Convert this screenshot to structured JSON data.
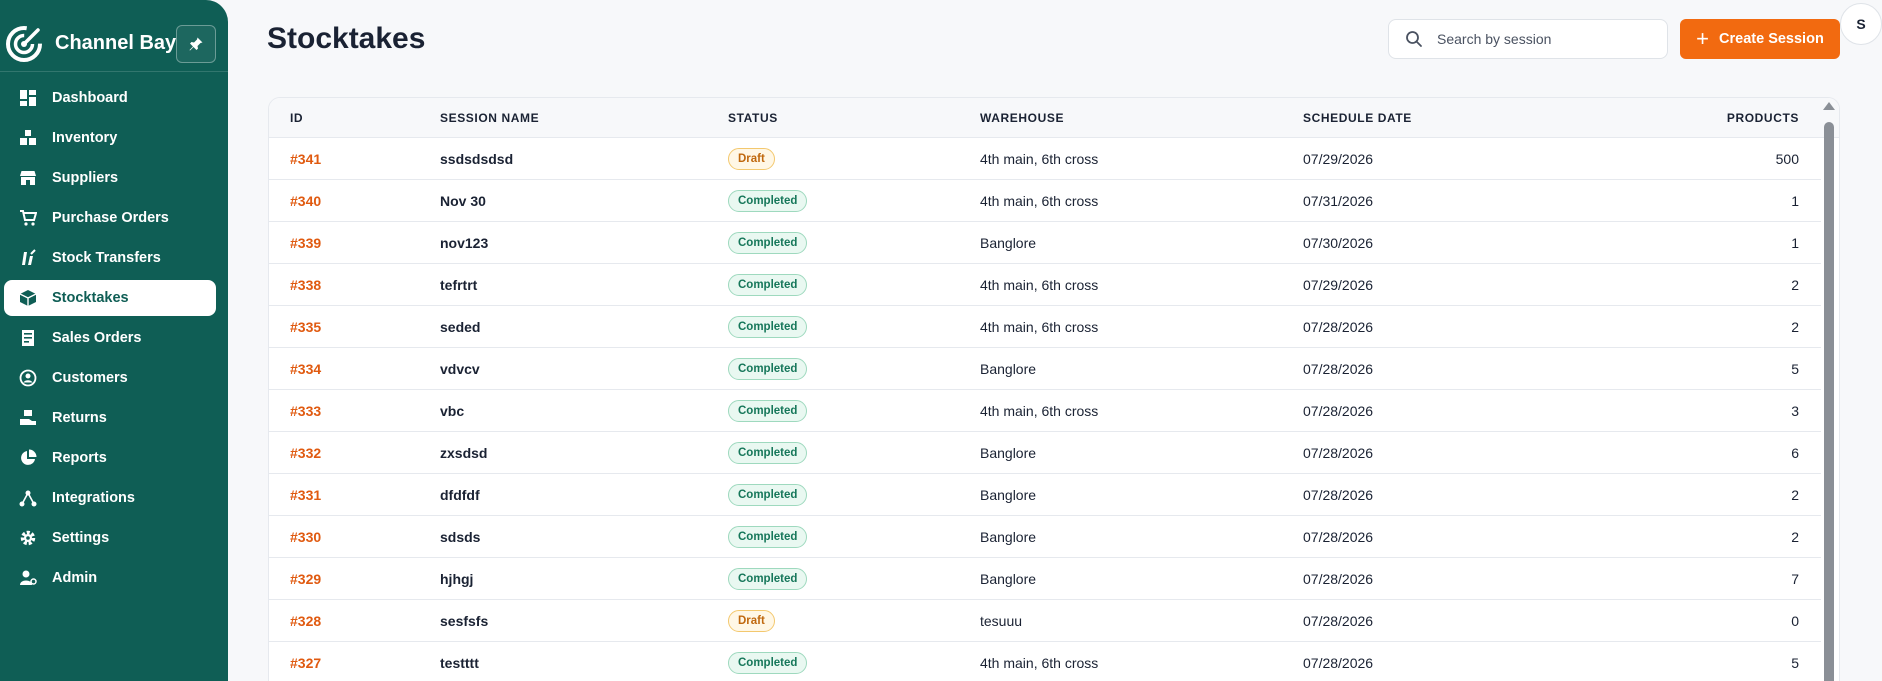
{
  "brand": {
    "name": "Channel Bay"
  },
  "sidebar": {
    "items": [
      {
        "label": "Dashboard",
        "icon": "dashboard-icon",
        "active": false
      },
      {
        "label": "Inventory",
        "icon": "inventory-icon",
        "active": false
      },
      {
        "label": "Suppliers",
        "icon": "store-icon",
        "active": false
      },
      {
        "label": "Purchase Orders",
        "icon": "cart-icon",
        "active": false
      },
      {
        "label": "Stock Transfers",
        "icon": "transfer-icon",
        "active": false
      },
      {
        "label": "Stocktakes",
        "icon": "box-icon",
        "active": true
      },
      {
        "label": "Sales Orders",
        "icon": "receipt-icon",
        "active": false
      },
      {
        "label": "Customers",
        "icon": "customers-icon",
        "active": false
      },
      {
        "label": "Returns",
        "icon": "returns-icon",
        "active": false
      },
      {
        "label": "Reports",
        "icon": "pie-chart-icon",
        "active": false
      },
      {
        "label": "Integrations",
        "icon": "integrations-icon",
        "active": false
      },
      {
        "label": "Settings",
        "icon": "gear-icon",
        "active": false
      },
      {
        "label": "Admin",
        "icon": "admin-icon",
        "active": false
      }
    ]
  },
  "header": {
    "title": "Stocktakes",
    "search_placeholder": "Search by session",
    "create_label": "Create Session",
    "avatar_initial": "S"
  },
  "colors": {
    "sidebar_bg": "#0f5e55",
    "accent": "#f26a10",
    "completed": "#16775a",
    "draft": "#c0680e"
  },
  "table": {
    "columns": {
      "id": "ID",
      "session_name": "SESSION NAME",
      "status": "STATUS",
      "warehouse": "WAREHOUSE",
      "schedule_date": "SCHEDULE DATE",
      "products": "PRODUCTS"
    },
    "rows": [
      {
        "id": "#341",
        "name": "ssdsdsdsd",
        "status": "Draft",
        "warehouse": "4th main, 6th cross",
        "date": "07/29/2026",
        "products": "500"
      },
      {
        "id": "#340",
        "name": "Nov 30",
        "status": "Completed",
        "warehouse": "4th main, 6th cross",
        "date": "07/31/2026",
        "products": "1"
      },
      {
        "id": "#339",
        "name": "nov123",
        "status": "Completed",
        "warehouse": "Banglore",
        "date": "07/30/2026",
        "products": "1"
      },
      {
        "id": "#338",
        "name": "tefrtrt",
        "status": "Completed",
        "warehouse": "4th main, 6th cross",
        "date": "07/29/2026",
        "products": "2"
      },
      {
        "id": "#335",
        "name": "seded",
        "status": "Completed",
        "warehouse": "4th main, 6th cross",
        "date": "07/28/2026",
        "products": "2"
      },
      {
        "id": "#334",
        "name": "vdvcv",
        "status": "Completed",
        "warehouse": "Banglore",
        "date": "07/28/2026",
        "products": "5"
      },
      {
        "id": "#333",
        "name": "vbc",
        "status": "Completed",
        "warehouse": "4th main, 6th cross",
        "date": "07/28/2026",
        "products": "3"
      },
      {
        "id": "#332",
        "name": "zxsdsd",
        "status": "Completed",
        "warehouse": "Banglore",
        "date": "07/28/2026",
        "products": "6"
      },
      {
        "id": "#331",
        "name": "dfdfdf",
        "status": "Completed",
        "warehouse": "Banglore",
        "date": "07/28/2026",
        "products": "2"
      },
      {
        "id": "#330",
        "name": "sdsds",
        "status": "Completed",
        "warehouse": "Banglore",
        "date": "07/28/2026",
        "products": "2"
      },
      {
        "id": "#329",
        "name": "hjhgj",
        "status": "Completed",
        "warehouse": "Banglore",
        "date": "07/28/2026",
        "products": "7"
      },
      {
        "id": "#328",
        "name": "sesfsfs",
        "status": "Draft",
        "warehouse": "tesuuu",
        "date": "07/28/2026",
        "products": "0"
      },
      {
        "id": "#327",
        "name": "testttt",
        "status": "Completed",
        "warehouse": "4th main, 6th cross",
        "date": "07/28/2026",
        "products": "5"
      }
    ]
  }
}
